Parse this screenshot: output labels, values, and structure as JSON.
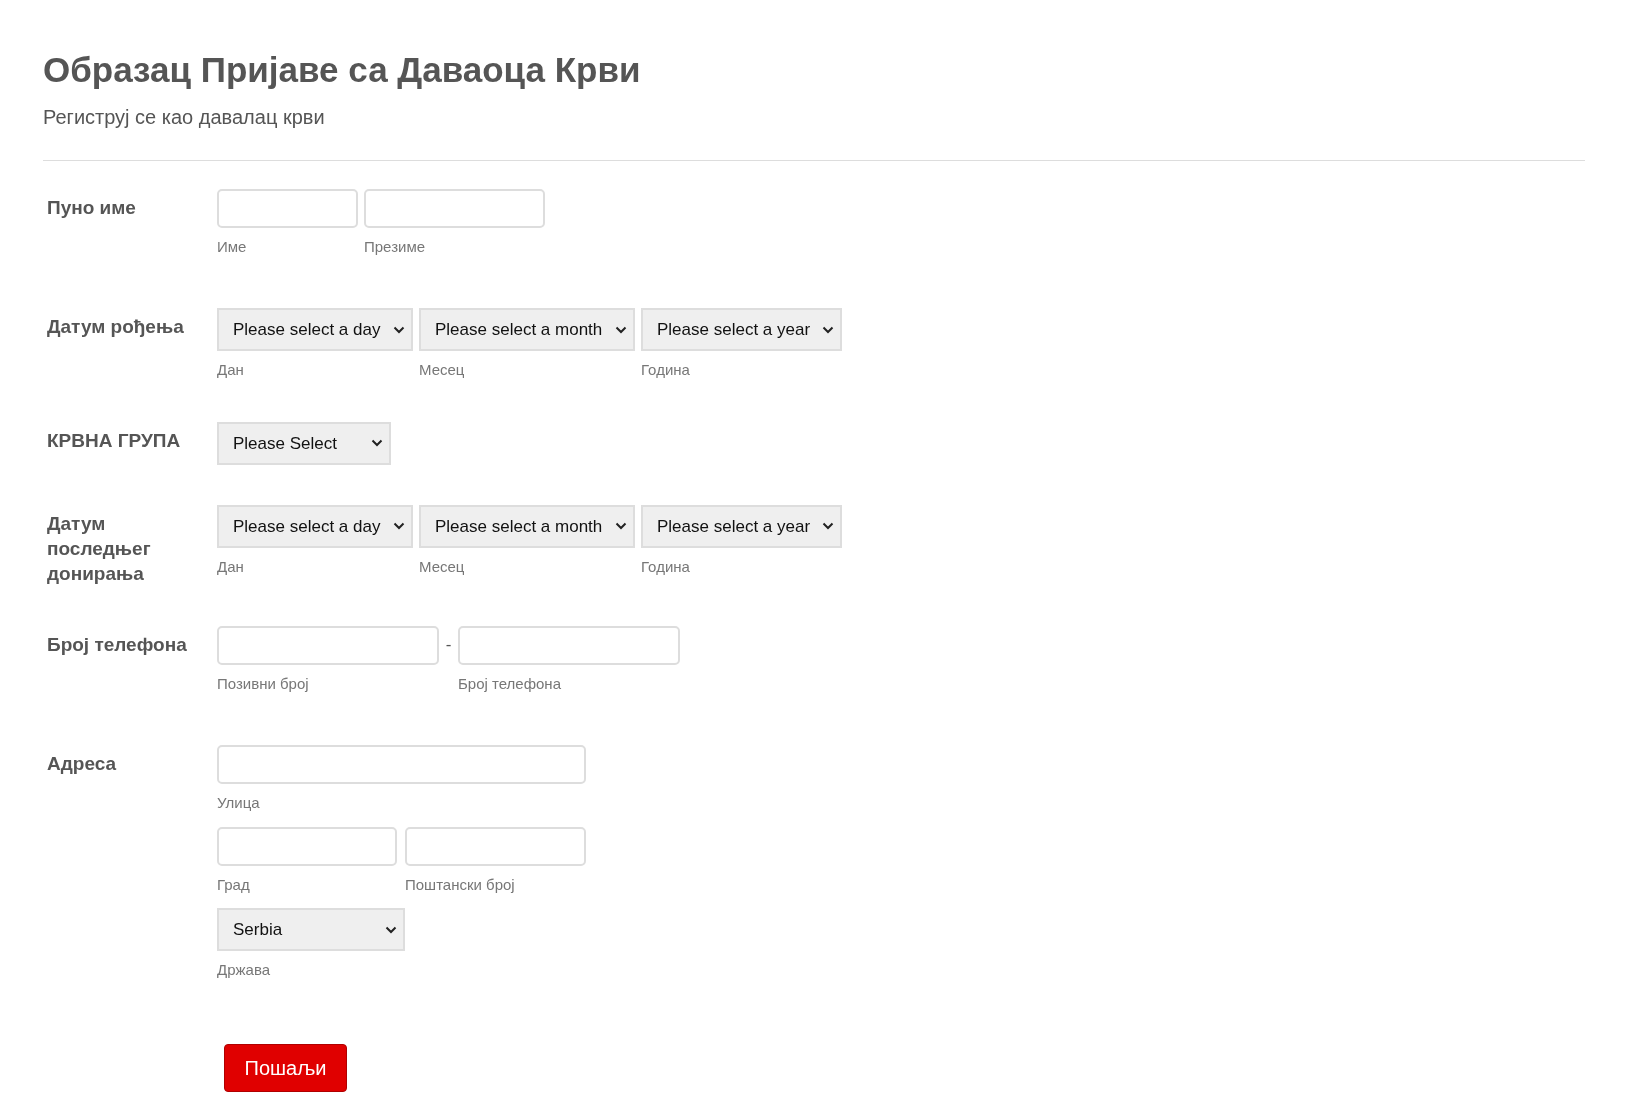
{
  "title": "Образац Пријаве са Даваоца Крви",
  "subtitle": "Региструј се као давалац крви",
  "fields": [
    {
      "kind": "fullname",
      "label": "Пуно име",
      "controls": [
        {
          "sublabel": "Име"
        },
        {
          "sublabel": "Презиме"
        }
      ]
    },
    {
      "kind": "date",
      "label": "Датум рођења",
      "controls": [
        {
          "value": "Please select a day",
          "sublabel": "Дан"
        },
        {
          "value": "Please select a month",
          "sublabel": "Месец"
        },
        {
          "value": "Please select a year",
          "sublabel": "Година"
        }
      ]
    },
    {
      "kind": "select",
      "label": "КРВНА ГРУПА",
      "controls": [
        {
          "value": "Please Select"
        }
      ]
    },
    {
      "kind": "date",
      "label": "Датум последњег донирања",
      "controls": [
        {
          "value": "Please select a day",
          "sublabel": "Дан"
        },
        {
          "value": "Please select a month",
          "sublabel": "Месец"
        },
        {
          "value": "Please select a year",
          "sublabel": "Година"
        }
      ]
    },
    {
      "kind": "phone",
      "label": "Број телефона",
      "separator": "-",
      "controls": [
        {
          "sublabel": "Позивни број"
        },
        {
          "sublabel": "Број телефона"
        }
      ]
    },
    {
      "kind": "address",
      "label": "Адреса",
      "controls": [
        {
          "sublabel": "Улица"
        },
        {
          "sublabel": "Град"
        },
        {
          "sublabel": "Поштански број"
        },
        {
          "value": "Serbia",
          "sublabel": "Држава"
        }
      ]
    }
  ],
  "submit": "Пошаљи"
}
